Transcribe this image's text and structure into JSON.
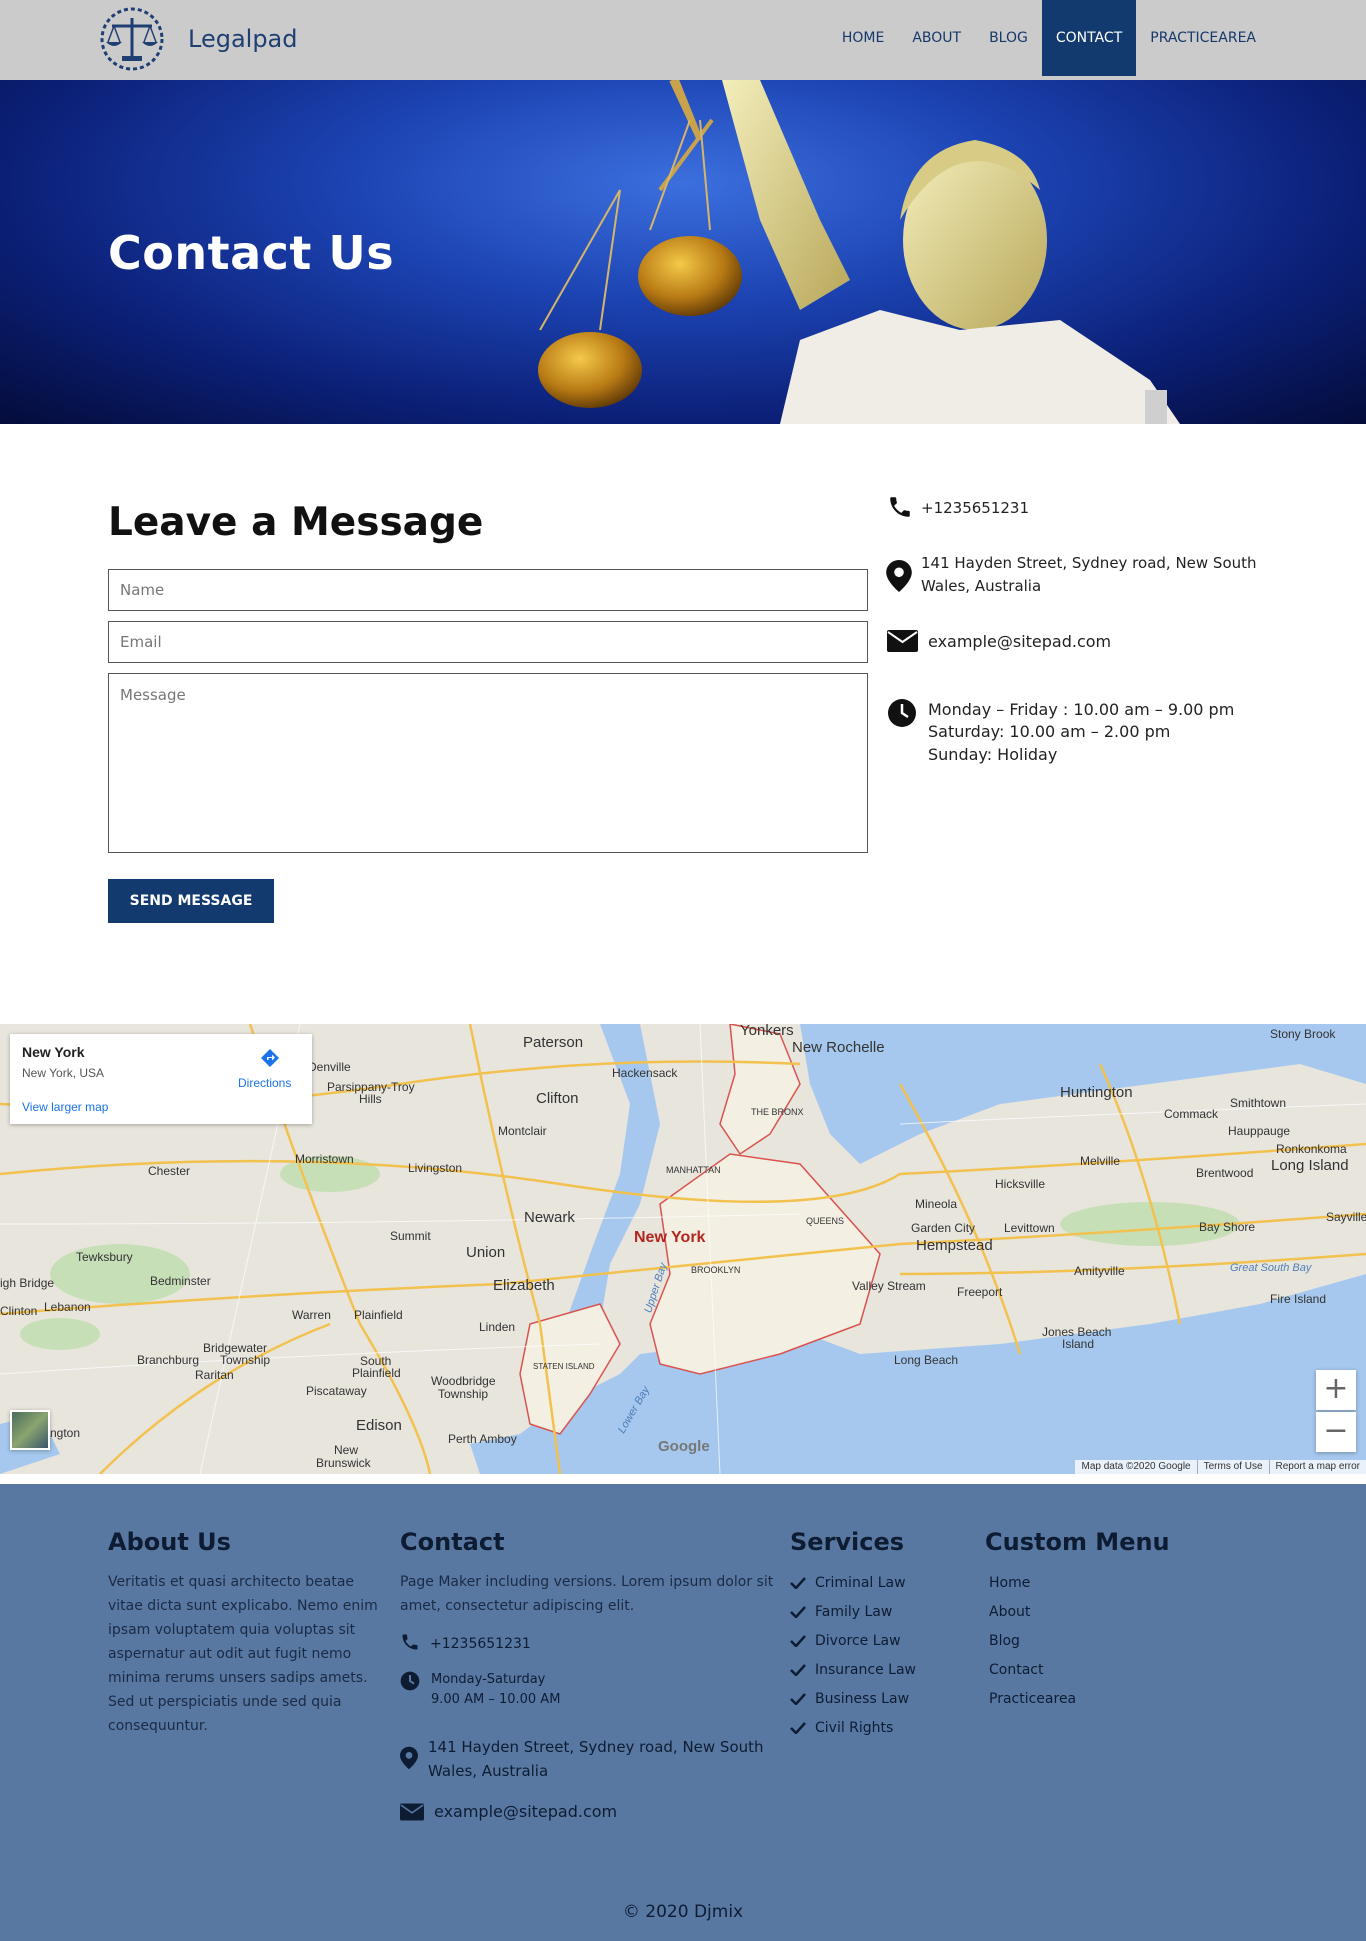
{
  "header": {
    "brand": "Legalpad",
    "nav": [
      {
        "label": "HOME"
      },
      {
        "label": "ABOUT"
      },
      {
        "label": "BLOG"
      },
      {
        "label": "CONTACT",
        "active": true
      },
      {
        "label": "PRACTICEAREA"
      }
    ]
  },
  "hero": {
    "title": "Contact Us"
  },
  "form": {
    "title": "Leave a Message",
    "name_placeholder": "Name",
    "email_placeholder": "Email",
    "message_placeholder": "Message",
    "send_label": "SEND MESSAGE"
  },
  "contact_info": {
    "phone": "+1235651231",
    "address_line1": "141 Hayden Street, Sydney road, New South",
    "address_line2": "Wales, Australia",
    "email": "example@sitepad.com",
    "hours_line1": "Monday – Friday : 10.00 am – 9.00 pm",
    "hours_line2": "Saturday: 10.00 am – 2.00 pm",
    "hours_line3": "Sunday: Holiday"
  },
  "map": {
    "place_title": "New York",
    "place_sub": "New York, USA",
    "directions": "Directions",
    "larger_map": "View larger map",
    "zoom_in": "+",
    "zoom_out": "−",
    "google": "Google",
    "footer": [
      "Map data ©2020 Google",
      "Terms of Use",
      "Report a map error"
    ],
    "labels": {
      "yonkers": "Yonkers",
      "paterson": "Paterson",
      "new_rochelle": "New Rochelle",
      "stony_brook": "Stony Brook",
      "hackensack": "Hackensack",
      "huntington": "Huntington",
      "clifton": "Clifton",
      "the_bronx": "THE BRONX",
      "smithtown": "Smithtown",
      "montclair": "Montclair",
      "commack": "Commack",
      "hauppauge": "Hauppauge",
      "ronkonkoma": "Ronkonkoma",
      "morristown": "Morristown",
      "livingston": "Livingston",
      "manhattan": "MANHATTAN",
      "melville": "Melville",
      "chester": "Chester",
      "brentwood": "Brentwood",
      "long_island": "Long Island",
      "hicksville": "Hicksville",
      "newark": "Newark",
      "mineola": "Mineola",
      "queens": "QUEENS",
      "sayville": "Sayville",
      "summit": "Summit",
      "new_york": "New York",
      "garden_city": "Garden City",
      "levittown": "Levittown",
      "bay_shore": "Bay Shore",
      "tewksbury": "Tewksbury",
      "union": "Union",
      "hempstead": "Hempstead",
      "brooklyn": "BROOKLYN",
      "great_south_bay": "Great South Bay",
      "amityville": "Amityville",
      "bedminster": "Bedminster",
      "elizabeth": "Elizabeth",
      "high_bridge": "igh Bridge",
      "valley_stream": "Valley Stream",
      "freeport": "Freeport",
      "fire_island": "Fire Island",
      "clinton": "Clinton",
      "lebanon": "Lebanon",
      "plainfield": "Plainfield",
      "warren": "Warren",
      "linden": "Linden",
      "jones_beach_1": "Jones Beach",
      "jones_beach_2": "Island",
      "bridgewater_1": "Bridgewater",
      "bridgewater_2": "Township",
      "branchburg": "Branchburg",
      "staten_island": "STATEN ISLAND",
      "long_beach": "Long Beach",
      "raritan": "Raritan",
      "south_plainfield_1": "South",
      "south_plainfield_2": "Plainfield",
      "woodbridge_1": "Woodbridge",
      "woodbridge_2": "Township",
      "piscataway": "Piscataway",
      "upper_bay": "Upper Bay",
      "lower_bay": "Lower Bay",
      "edison": "Edison",
      "perth_amboy": "Perth Amboy",
      "new_brunswick_1": "New",
      "new_brunswick_2": "Brunswick",
      "ngton": "ngton",
      "parsippany_1": "Parsippany-Troy",
      "parsippany_2": "Hills",
      "denville": "Denville"
    }
  },
  "footer": {
    "about_title": "About Us",
    "about_text": "Veritatis et quasi architecto beatae vitae dicta sunt explicabo. Nemo enim ipsam voluptatem quia voluptas sit aspernatur aut odit aut fugit nemo minima rerums unsers sadips amets. Sed ut perspiciatis unde sed quia consequuntur.",
    "contact_title": "Contact",
    "contact_text": "Page Maker including versions. Lorem ipsum dolor sit amet, consectetur adipiscing elit.",
    "phone": "+1235651231",
    "hours_line1": "Monday-Saturday",
    "hours_line2": "9.00 AM – 10.00 AM",
    "address_line1": "141 Hayden Street, Sydney road, New South",
    "address_line2": "Wales, Australia",
    "email": "example@sitepad.com",
    "services_title": "Services",
    "services": [
      "Criminal Law",
      "Family Law",
      "Divorce Law",
      "Insurance Law",
      "Business Law",
      "Civil Rights"
    ],
    "menu_title": "Custom Menu",
    "menu": [
      "Home",
      "About",
      "Blog",
      "Contact",
      "Practicearea"
    ],
    "copyright": "© 2020 Djmix"
  },
  "colors": {
    "header_bg": "#cbcbcb",
    "brand": "#1f3f73",
    "accent": "#123a6e",
    "footer_bg": "#5878a1"
  },
  "icons": [
    "scales-logo-icon",
    "phone-icon",
    "map-pin-icon",
    "envelope-icon",
    "clock-icon",
    "check-icon",
    "directions-icon"
  ]
}
